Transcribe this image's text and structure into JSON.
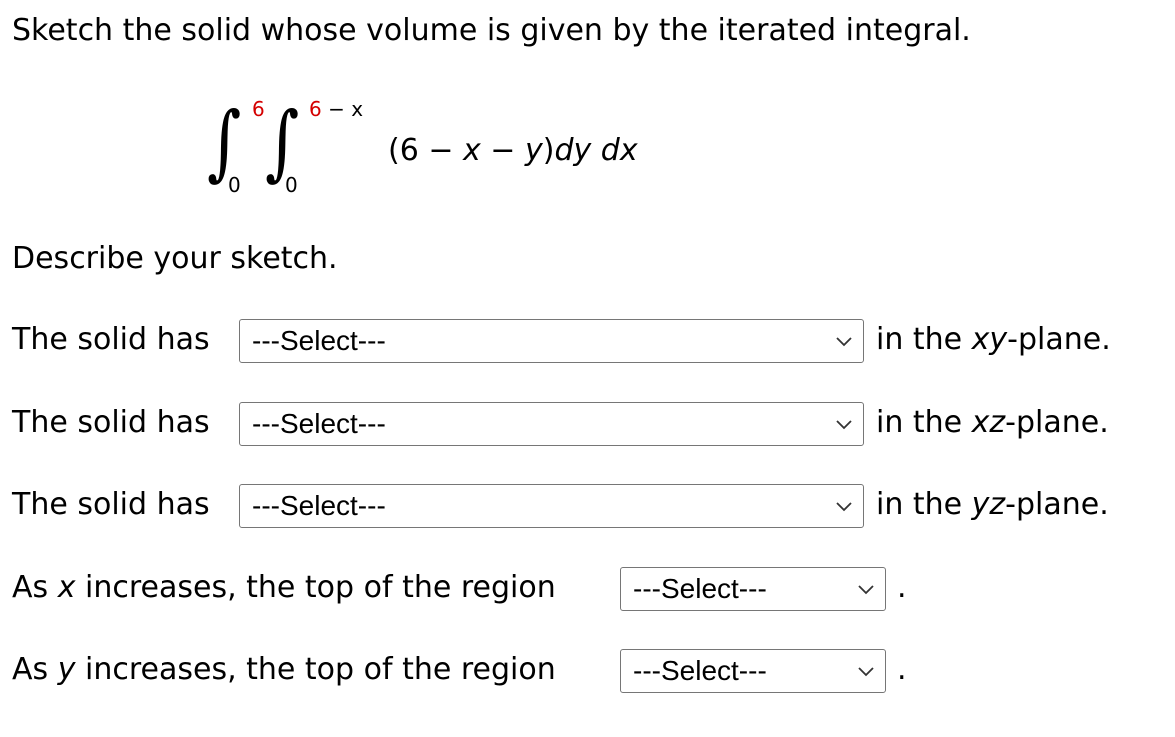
{
  "heading": "Sketch the solid whose volume is given by the iterated integral.",
  "integral": {
    "outer_upper": "6",
    "outer_lower": "0",
    "inner_upper_number": "6",
    "inner_upper_rest": " − x",
    "inner_lower": "0",
    "integrand_open": "(6 − ",
    "integrand_x": "x",
    "integrand_minus": " − ",
    "integrand_y": "y",
    "integrand_close": ")",
    "integrand_dy": "dy dx"
  },
  "describe_prompt": "Describe your sketch.",
  "rows": [
    {
      "prefix": "The solid has",
      "select_value": "---Select---",
      "suffix_pre": "in the ",
      "suffix_plane": "xy",
      "suffix_post": "-plane."
    },
    {
      "prefix": "The solid has",
      "select_value": "---Select---",
      "suffix_pre": "in the ",
      "suffix_plane": "xz",
      "suffix_post": "-plane."
    },
    {
      "prefix": "The solid has",
      "select_value": "---Select---",
      "suffix_pre": "in the ",
      "suffix_plane": "yz",
      "suffix_post": "-plane."
    }
  ],
  "increase_rows": [
    {
      "pre": "As ",
      "variable": "x",
      "post": " increases, the top of the region",
      "select_value": "---Select---",
      "end": "."
    },
    {
      "pre": "As ",
      "variable": "y",
      "post": " increases, the top of the region",
      "select_value": "---Select---",
      "end": "."
    }
  ],
  "colors": {
    "upper_limit": "#d40000",
    "select_border": "#767676"
  }
}
